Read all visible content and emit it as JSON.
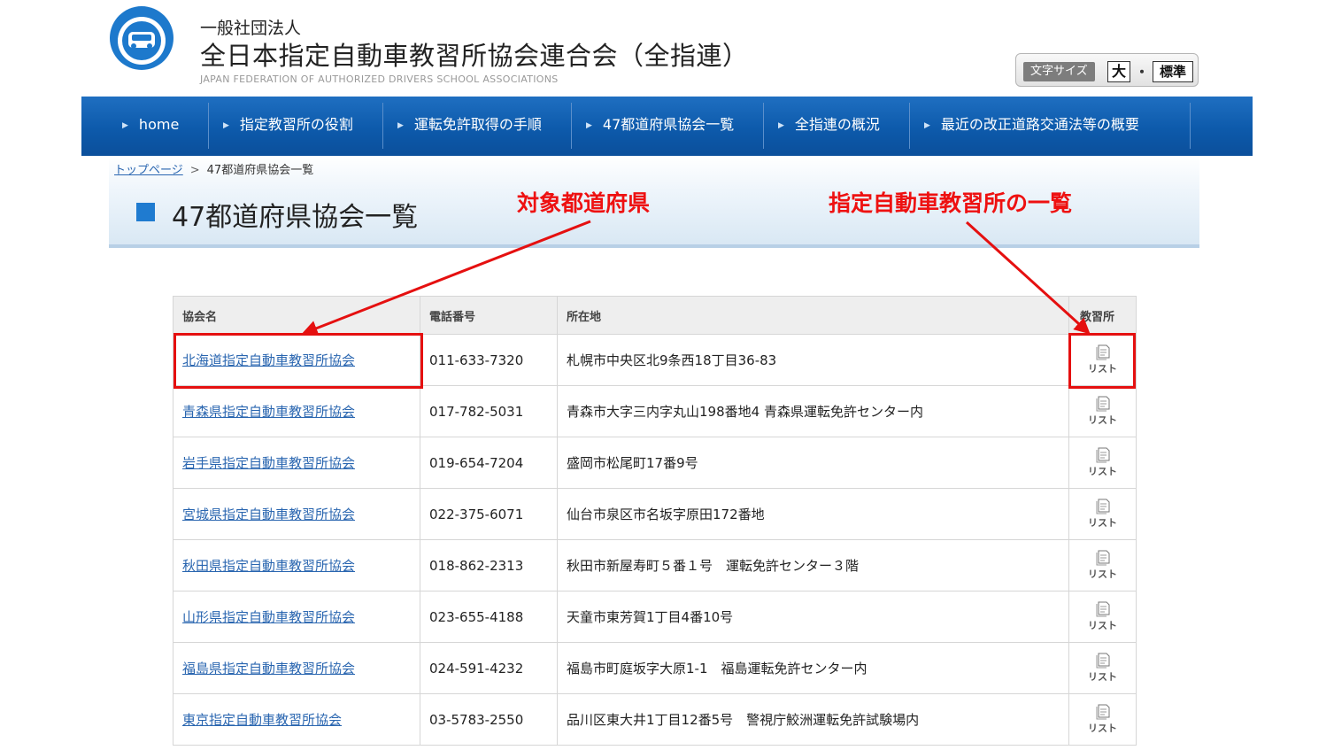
{
  "header": {
    "org_sub": "一般社団法人",
    "org_name": "全日本指定自動車教習所協会連合会（全指連）",
    "org_en": "JAPAN FEDERATION OF AUTHORIZED DRIVERS SCHOOL ASSOCIATIONS",
    "logo_icon": "car-logo-icon"
  },
  "font_size": {
    "label": "文字サイズ",
    "large": "大",
    "dot": "・",
    "standard": "標準"
  },
  "nav": [
    {
      "label": "home"
    },
    {
      "label": "指定教習所の役割"
    },
    {
      "label": "運転免許取得の手順"
    },
    {
      "label": "47都道府県協会一覧"
    },
    {
      "label": "全指連の概況"
    },
    {
      "label": "最近の改正道路交通法等の概要"
    }
  ],
  "breadcrumb": {
    "home": "トップページ",
    "sep": ">",
    "current": "47都道府県協会一覧"
  },
  "page_title": "47都道府県協会一覧",
  "annotations": {
    "left": "対象都道府県",
    "right": "指定自動車教習所の一覧",
    "color": "#ee1111"
  },
  "table": {
    "headers": {
      "name": "協会名",
      "phone": "電話番号",
      "address": "所在地",
      "list": "教習所"
    },
    "list_label": "リスト",
    "rows": [
      {
        "name": "北海道指定自動車教習所協会",
        "phone": "011-633-7320",
        "address": "札幌市中央区北9条西18丁目36-83"
      },
      {
        "name": "青森県指定自動車教習所協会",
        "phone": "017-782-5031",
        "address": "青森市大字三内字丸山198番地4 青森県運転免許センター内"
      },
      {
        "name": "岩手県指定自動車教習所協会",
        "phone": "019-654-7204",
        "address": "盛岡市松尾町17番9号"
      },
      {
        "name": "宮城県指定自動車教習所協会",
        "phone": "022-375-6071",
        "address": "仙台市泉区市名坂字原田172番地"
      },
      {
        "name": "秋田県指定自動車教習所協会",
        "phone": "018-862-2313",
        "address": "秋田市新屋寿町５番１号　運転免許センター３階"
      },
      {
        "name": "山形県指定自動車教習所協会",
        "phone": "023-655-4188",
        "address": "天童市東芳賀1丁目4番10号"
      },
      {
        "name": "福島県指定自動車教習所協会",
        "phone": "024-591-4232",
        "address": "福島市町庭坂字大原1-1　福島運転免許センター内"
      },
      {
        "name": "東京指定自動車教習所協会",
        "phone": "03-5783-2550",
        "address": "品川区東大井1丁目12番5号　警視庁鮫洲運転免許試験場内"
      }
    ]
  }
}
